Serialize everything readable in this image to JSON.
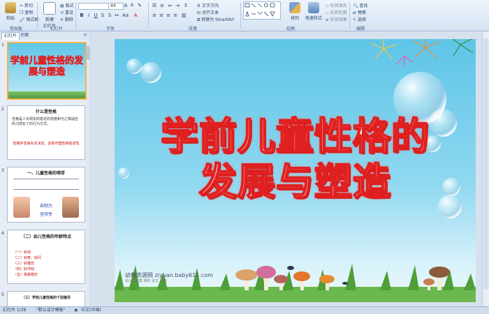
{
  "ribbon": {
    "paste_label": "粘贴",
    "clipboard_items": [
      "剪切",
      "复制",
      "格式刷"
    ],
    "new_slide_label": "新建\n幻灯片",
    "slide_items": [
      "版式",
      "重设",
      "删除"
    ],
    "font_size": "44",
    "text_direction": "文字方向",
    "align_text": "对齐文本",
    "smartart": "转换为 SmartArt",
    "arrange": "排列",
    "quick_styles": "快速样式",
    "shape_fill": "形状填充",
    "shape_outline": "形状轮廓",
    "shape_effects": "形状效果",
    "find": "查找",
    "replace": "替换",
    "select": "选择",
    "group_labels": [
      "剪贴板",
      "幻灯片",
      "字体",
      "段落",
      "绘图",
      "编辑"
    ]
  },
  "tabs": {
    "slides": "幻灯片",
    "outline": "大纲",
    "close": "×"
  },
  "thumbnails": [
    {
      "num": "1",
      "title": "学前儿童性格的发展与塑造"
    },
    {
      "num": "2",
      "heading": "什么是性格",
      "body": "性格是人对现实的稳定的态度和与之相适应的习惯化了的行为方式。",
      "footer": "性格并非由先天决定，具有可塑性和稳定性"
    },
    {
      "num": "3",
      "heading": "一、儿童性格的萌芽",
      "labels": [
        "自制力",
        "坚持性"
      ]
    },
    {
      "num": "4",
      "heading": "（二）幼儿性格的年龄特点",
      "items": [
        "（一）好动",
        "（二）好奇、好问",
        "（三）好模仿",
        "（四）好冲动",
        "（五）易受暗示"
      ]
    },
    {
      "num": "5",
      "heading": "（三）学前儿童性格的个别差异"
    }
  ],
  "slide": {
    "title_line1": "学前儿童性格的",
    "title_line2": "发展与塑造",
    "watermark": "幼教资源网 ziyuan.baby611.com",
    "watermark_sub": "幼儿园教案 课件 论文 试题"
  },
  "status": {
    "slide_count": "幻灯片 1/38",
    "theme": "\"默认设计模板\"",
    "language": "中文(中国)"
  },
  "colors": {
    "title_red": "#e02020",
    "sky_top": "#5ec5e8",
    "ribbon_bg": "#dbe6f3"
  }
}
